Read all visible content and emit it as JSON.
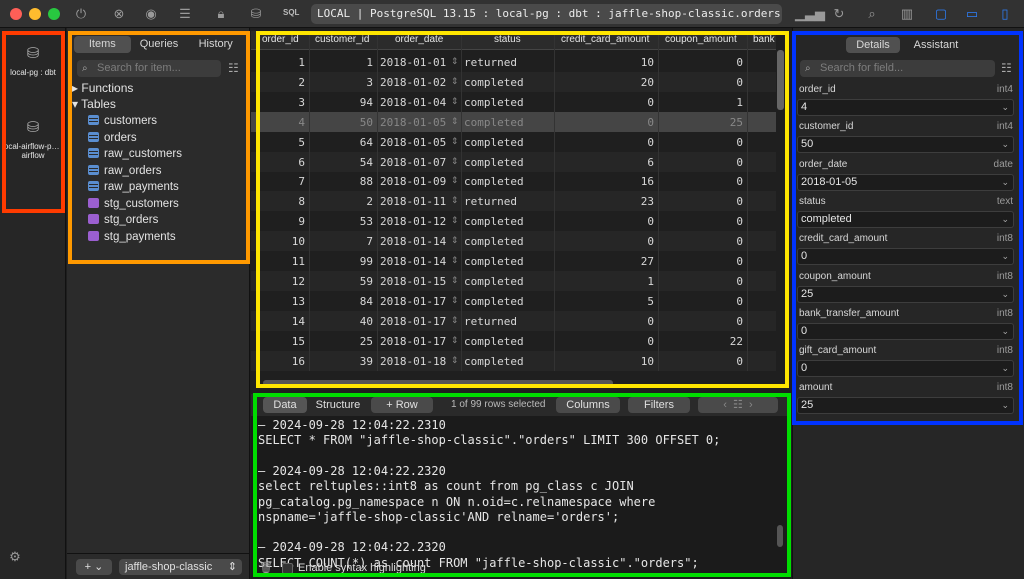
{
  "window": {
    "address": "LOCAL | PostgreSQL 13.15 : local-pg : dbt : jaffle-shop-classic.orders",
    "sql_button": "SQL"
  },
  "connections": [
    {
      "label": "local-pg : dbt"
    },
    {
      "label": "local-airflow-p… : airflow"
    }
  ],
  "navigator": {
    "tabs": [
      "Items",
      "Queries",
      "History"
    ],
    "active_tab": "Items",
    "search_placeholder": "Search for item...",
    "groups": [
      "Functions",
      "Tables"
    ],
    "items": [
      {
        "name": "customers",
        "kind": "table"
      },
      {
        "name": "orders",
        "kind": "table"
      },
      {
        "name": "raw_customers",
        "kind": "table"
      },
      {
        "name": "raw_orders",
        "kind": "table"
      },
      {
        "name": "raw_payments",
        "kind": "table"
      },
      {
        "name": "stg_customers",
        "kind": "view"
      },
      {
        "name": "stg_orders",
        "kind": "view"
      },
      {
        "name": "stg_payments",
        "kind": "view"
      }
    ],
    "add_label": "+",
    "schema": "jaffle-shop-classic"
  },
  "grid": {
    "columns": [
      "order_id",
      "customer_id",
      "order_date",
      "status",
      "credit_card_amount",
      "coupon_amount",
      "bank"
    ],
    "rows": [
      [
        "1",
        "1",
        "2018-01-01",
        "returned",
        "10",
        "0"
      ],
      [
        "2",
        "3",
        "2018-01-02",
        "completed",
        "20",
        "0"
      ],
      [
        "3",
        "94",
        "2018-01-04",
        "completed",
        "0",
        "1"
      ],
      [
        "4",
        "50",
        "2018-01-05",
        "completed",
        "0",
        "25"
      ],
      [
        "5",
        "64",
        "2018-01-05",
        "completed",
        "0",
        "0"
      ],
      [
        "6",
        "54",
        "2018-01-07",
        "completed",
        "6",
        "0"
      ],
      [
        "7",
        "88",
        "2018-01-09",
        "completed",
        "16",
        "0"
      ],
      [
        "8",
        "2",
        "2018-01-11",
        "returned",
        "23",
        "0"
      ],
      [
        "9",
        "53",
        "2018-01-12",
        "completed",
        "0",
        "0"
      ],
      [
        "10",
        "7",
        "2018-01-14",
        "completed",
        "0",
        "0"
      ],
      [
        "11",
        "99",
        "2018-01-14",
        "completed",
        "27",
        "0"
      ],
      [
        "12",
        "59",
        "2018-01-15",
        "completed",
        "1",
        "0"
      ],
      [
        "13",
        "84",
        "2018-01-17",
        "completed",
        "5",
        "0"
      ],
      [
        "14",
        "40",
        "2018-01-17",
        "returned",
        "0",
        "0"
      ],
      [
        "15",
        "25",
        "2018-01-17",
        "completed",
        "0",
        "22"
      ],
      [
        "16",
        "39",
        "2018-01-18",
        "completed",
        "10",
        "0"
      ]
    ],
    "selected_row": "4"
  },
  "bottombar": {
    "data_tab": "Data",
    "structure_tab": "Structure",
    "row_button": "Row",
    "status": "1 of 99 rows selected",
    "columns_button": "Columns",
    "filters_button": "Filters"
  },
  "console": {
    "lines": [
      "— 2024-09-28 12:04:22.2310",
      "SELECT * FROM \"jaffle-shop-classic\".\"orders\" LIMIT 300 OFFSET 0;",
      "",
      "— 2024-09-28 12:04:22.2320",
      "select reltuples::int8 as count from pg_class c JOIN",
      "pg_catalog.pg_namespace n ON n.oid=c.relnamespace where",
      "nspname='jaffle-shop-classic'AND relname='orders';",
      "",
      "— 2024-09-28 12:04:22.2320",
      "SELECT COUNT(*) as count FROM \"jaffle-shop-classic\".\"orders\";"
    ],
    "syntax_label": "Enable syntax highlighting"
  },
  "details": {
    "tabs": [
      "Details",
      "Assistant"
    ],
    "active_tab": "Details",
    "search_placeholder": "Search for field...",
    "fields": [
      {
        "name": "order_id",
        "type": "int4",
        "value": "4"
      },
      {
        "name": "customer_id",
        "type": "int4",
        "value": "50"
      },
      {
        "name": "order_date",
        "type": "date",
        "value": "2018-01-05"
      },
      {
        "name": "status",
        "type": "text",
        "value": "completed"
      },
      {
        "name": "credit_card_amount",
        "type": "int8",
        "value": "0"
      },
      {
        "name": "coupon_amount",
        "type": "int8",
        "value": "25"
      },
      {
        "name": "bank_transfer_amount",
        "type": "int8",
        "value": "0"
      },
      {
        "name": "gift_card_amount",
        "type": "int8",
        "value": "0"
      },
      {
        "name": "amount",
        "type": "int8",
        "value": "25"
      }
    ]
  },
  "colors": {
    "highlight_red": "#ff3b00",
    "highlight_orange": "#ff9900",
    "highlight_yellow": "#ffe600",
    "highlight_green": "#00dd00",
    "highlight_blue": "#0033ff",
    "accent": "#2d7ff9"
  }
}
